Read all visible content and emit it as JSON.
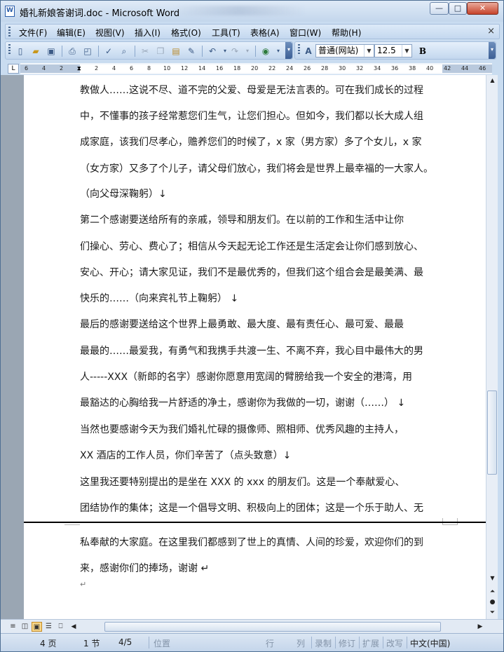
{
  "window": {
    "title": "婚礼新娘答谢词.doc - Microsoft Word",
    "min_label": "—",
    "max_label": "□",
    "close_label": "✕"
  },
  "menu": {
    "items": [
      "文件(F)",
      "编辑(E)",
      "视图(V)",
      "插入(I)",
      "格式(O)",
      "工具(T)",
      "表格(A)",
      "窗口(W)",
      "帮助(H)"
    ],
    "close_doc": "×"
  },
  "toolbar": {
    "style_value": "普通(网站)",
    "size_value": "12.5",
    "bold_label": "B",
    "icons": [
      "new-icon",
      "open-icon",
      "save-icon",
      "print-icon",
      "print-preview-icon",
      "spelling-icon",
      "research-icon",
      "cut-icon",
      "copy-icon",
      "paste-icon",
      "format-painter-icon",
      "undo-icon",
      "redo-icon",
      "hyperlink-icon",
      "styles-icon"
    ]
  },
  "ruler": {
    "corner": "L",
    "ticks": [
      "6",
      "4",
      "2",
      "2",
      "4",
      "6",
      "8",
      "10",
      "12",
      "14",
      "16",
      "18",
      "20",
      "22",
      "24",
      "26",
      "28",
      "30",
      "32",
      "34",
      "36",
      "38",
      "40",
      "42",
      "44",
      "46"
    ]
  },
  "document": {
    "lines": [
      "教做人……这说不尽、道不完的父爱、母爱是无法言表的。可在我们成长的过程",
      "中，不懂事的孩子经常惹您们生气，让您们担心。但如今，我们都以长大成人组",
      "成家庭，该我们尽孝心，赡养您们的时候了，x 家（男方家）多了个女儿，x 家",
      "（女方家）又多了个儿子，请父母们放心，我们将会是世界上最幸福的一大家人。",
      "（向父母深鞠躬）↓",
      "    第二个感谢要送给所有的亲戚，领导和朋友们。在以前的工作和生活中让你",
      "们操心、劳心、费心了；相信从今天起无论工作还是生活定会让你们感到放心、",
      "安心、开心；请大家见证，我们不是最优秀的，但我们这个组合会是最美满、最",
      "快乐的……（向来宾礼节上鞠躬）  ↓",
      "    最后的感谢要送给这个世界上最勇敢、最大度、最有责任心、最可爱、最最",
      "最最的……最爱我，有勇气和我携手共渡一生、不离不弃，我心目中最伟大的男",
      "人-----XXX（新郎的名字）感谢你愿意用宽阔的臂膀给我一个安全的港湾，用",
      "最豁达的心胸给我一片舒适的净土，感谢你为我做的一切，谢谢（……）  ↓",
      "    当然也要感谢今天为我们婚礼忙碌的摄像师、照相师、优秀风趣的主持人，",
      "XX 酒店的工作人员，你们辛苦了（点头致意）↓",
      "    这里我还要特别提出的是坐在 XXX 的 xxx 的朋友们。这是一个奉献爱心、",
      "团结协作的集体；这是一个倡导文明、积极向上的团体；这是一个乐于助人、无"
    ],
    "lines_after_break": [
      "私奉献的大家庭。在这里我们都感到了世上的真情、人间的珍爱，欢迎你们的到",
      "来，感谢你们的捧场，谢谢 ↵",
      "↵"
    ]
  },
  "statusbar": {
    "page": "4 页",
    "section": "1 节",
    "page_of": "4/5",
    "position": "位置",
    "line": "行",
    "column": "列",
    "record": "录制",
    "revise": "修订",
    "extend": "扩展",
    "overtype": "改写",
    "language": "中文(中国)"
  }
}
